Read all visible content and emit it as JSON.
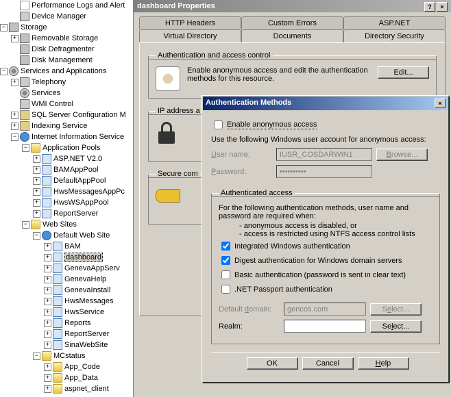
{
  "tree": [
    {
      "indent": 1,
      "icon": "page",
      "label": "Performance Logs and Alert"
    },
    {
      "indent": 1,
      "icon": "svc",
      "label": "Device Manager"
    },
    {
      "indent": 0,
      "toggle": "-",
      "icon": "disk",
      "label": "Storage"
    },
    {
      "indent": 1,
      "icon": "disk",
      "label": "Removable Storage",
      "toggle": "+"
    },
    {
      "indent": 1,
      "icon": "disk",
      "label": "Disk Defragmenter"
    },
    {
      "indent": 1,
      "icon": "disk",
      "label": "Disk Management"
    },
    {
      "indent": 0,
      "toggle": "-",
      "icon": "gear",
      "label": "Services and Applications"
    },
    {
      "indent": 1,
      "toggle": "+",
      "icon": "svc",
      "label": "Telephony"
    },
    {
      "indent": 1,
      "icon": "gear",
      "label": "Services"
    },
    {
      "indent": 1,
      "icon": "svc",
      "label": "WMI Control"
    },
    {
      "indent": 1,
      "toggle": "+",
      "icon": "db",
      "label": "SQL Server Configuration M"
    },
    {
      "indent": 1,
      "toggle": "+",
      "icon": "db",
      "label": "Indexing Service"
    },
    {
      "indent": 1,
      "toggle": "-",
      "icon": "globe",
      "label": "Internet Information Service"
    },
    {
      "indent": 2,
      "toggle": "-",
      "icon": "folder",
      "label": "Application Pools"
    },
    {
      "indent": 3,
      "toggle": "+",
      "icon": "app",
      "label": "ASP.NET V2.0"
    },
    {
      "indent": 3,
      "toggle": "+",
      "icon": "app",
      "label": "BAMAppPool"
    },
    {
      "indent": 3,
      "toggle": "+",
      "icon": "app",
      "label": "DefaultAppPool"
    },
    {
      "indent": 3,
      "toggle": "+",
      "icon": "app",
      "label": "HwsMessagesAppPc"
    },
    {
      "indent": 3,
      "toggle": "+",
      "icon": "app",
      "label": "HwsWSAppPool"
    },
    {
      "indent": 3,
      "toggle": "+",
      "icon": "app",
      "label": "ReportServer"
    },
    {
      "indent": 2,
      "toggle": "-",
      "icon": "folder",
      "label": "Web Sites"
    },
    {
      "indent": 3,
      "toggle": "-",
      "icon": "globe",
      "label": "Default Web Site"
    },
    {
      "indent": 4,
      "toggle": "+",
      "icon": "app",
      "label": "BAM"
    },
    {
      "indent": 4,
      "toggle": "+",
      "icon": "app",
      "label": "dashboard",
      "selected": true
    },
    {
      "indent": 4,
      "toggle": "+",
      "icon": "app",
      "label": "GenevaAppServ"
    },
    {
      "indent": 4,
      "toggle": "+",
      "icon": "app",
      "label": "GenevaHelp"
    },
    {
      "indent": 4,
      "toggle": "+",
      "icon": "app",
      "label": "GenevaInstall"
    },
    {
      "indent": 4,
      "toggle": "+",
      "icon": "app",
      "label": "HwsMessages"
    },
    {
      "indent": 4,
      "toggle": "+",
      "icon": "app",
      "label": "HwsService"
    },
    {
      "indent": 4,
      "toggle": "+",
      "icon": "app",
      "label": "Reports"
    },
    {
      "indent": 4,
      "toggle": "+",
      "icon": "app",
      "label": "ReportServer"
    },
    {
      "indent": 4,
      "toggle": "+",
      "icon": "app",
      "label": "SinaWebSite"
    },
    {
      "indent": 3,
      "toggle": "-",
      "icon": "folder",
      "label": "MCstatus"
    },
    {
      "indent": 4,
      "toggle": "+",
      "icon": "folder",
      "label": "App_Code"
    },
    {
      "indent": 4,
      "toggle": "+",
      "icon": "folder",
      "label": "App_Data"
    },
    {
      "indent": 4,
      "toggle": "+",
      "icon": "folder",
      "label": "aspnet_client"
    }
  ],
  "props": {
    "title": "dashboard Properties",
    "tabs_row1": [
      "HTTP Headers",
      "Custom Errors",
      "ASP.NET"
    ],
    "tabs_row2": [
      "Virtual Directory",
      "Documents",
      "Directory Security"
    ],
    "active_tab": "Directory Security",
    "group1": {
      "legend": "Authentication and access control",
      "text": "Enable anonymous access and edit the authentication methods for this resource.",
      "button": "Edit..."
    },
    "group2": {
      "legend": "IP address a"
    },
    "group3": {
      "legend": "Secure com"
    }
  },
  "auth": {
    "title": "Authentication Methods",
    "anon_check": "Enable anonymous access",
    "anon_text": "Use the following Windows user account for anonymous access:",
    "user_label": "User name:",
    "user_value": "IUSR_COSDARWIN1",
    "browse": "Browse...",
    "pass_label": "Password:",
    "pass_value": "••••••••••",
    "auth_legend": "Authenticated access",
    "auth_text1": "For the following authentication methods, user name and password are required when:",
    "auth_bullet1": "- anonymous access is disabled, or",
    "auth_bullet2": "- access is restricted using NTFS access control lists",
    "cb1": "Integrated Windows authentication",
    "cb2": "Digest authentication for Windows domain servers",
    "cb3": "Basic authentication (password is sent in clear text)",
    "cb4": ".NET Passport authentication",
    "domain_label": "Default domain:",
    "domain_value": "gencos.com",
    "realm_label": "Realm:",
    "realm_value": "",
    "select_btn": "Select...",
    "ok": "OK",
    "cancel": "Cancel",
    "help": "Help"
  }
}
